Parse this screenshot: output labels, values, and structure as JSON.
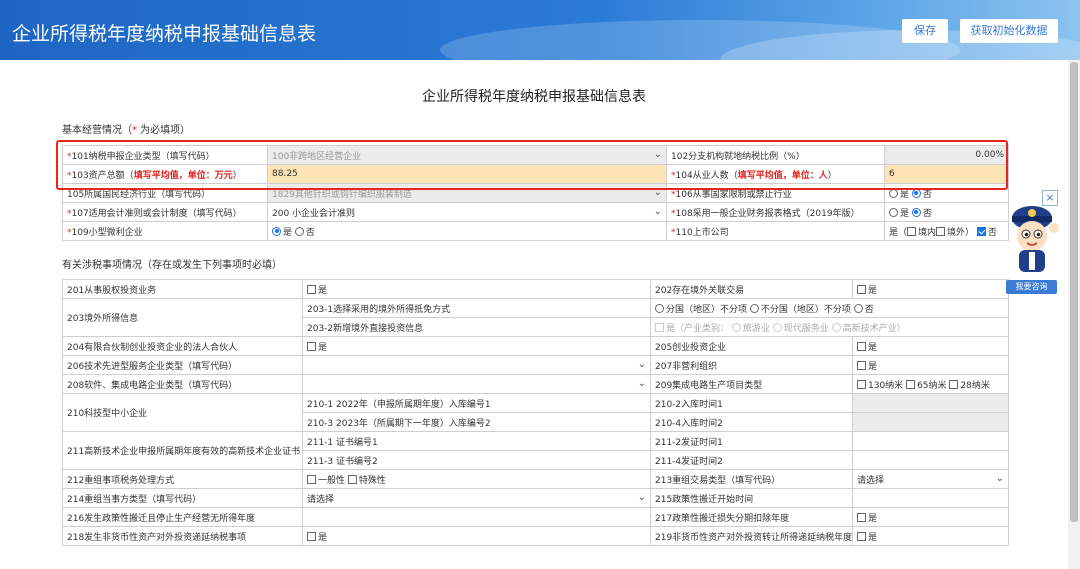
{
  "header": {
    "title": "企业所得税年度纳税申报基础信息表",
    "save_label": "保存",
    "init_label": "获取初始化数据"
  },
  "doc_title": "企业所得税年度纳税申报基础信息表",
  "section1": {
    "title_prefix": "基本经营情况（",
    "required_mark": "*",
    "title_suffix": " 为必填项）"
  },
  "basic": {
    "r101_label": "101纳税申报企业类型（填写代码）",
    "r101_value": "100非跨地区经营企业",
    "r102_label": "102分支机构就地纳税比例（%）",
    "r102_value": "0.00%",
    "r103_label": "103资产总额（",
    "r103_note": "填写平均值，单位：万元",
    "r103_end": "）",
    "r103_value": "88.25",
    "r104_label": "104从业人数（",
    "r104_note": "填写平均值，单位：人",
    "r104_end": "）",
    "r104_value": "6",
    "r105_label": "105所属国民经济行业（填写代码）",
    "r105_value": "1829其他针织或钩针编织服装制造",
    "r106_label": "106从事国家限制或禁止行业",
    "yes": "是",
    "no": "否",
    "r107_label": "107适用会计准则或会计制度（填写代码）",
    "r107_value": "200 小企业会计准则",
    "r108_label": "108采用一般企业财务报表格式（2019年版）",
    "r109_label": "109小型微利企业",
    "r110_label": "110上市公司",
    "r110_prefix": "是（",
    "r110_in": "境内",
    "r110_out": "境外）"
  },
  "section2": {
    "title": "有关涉税事项情况（存在或发生下列事项时必填）"
  },
  "tax": {
    "r201": "201从事股权投资业务",
    "r202": "202存在境外关联交易",
    "r203": "203境外所得信息",
    "r203_1": "203-1选择采用的境外所得抵免方式",
    "r203_1_a": "分国（地区）不分项",
    "r203_1_b": "不分国（地区）不分项",
    "r203_1_c": "否",
    "r203_2": "203-2新增境外直接投资信息",
    "r203_2_a": "是（产业类别：",
    "r203_2_b": "旅游业",
    "r203_2_c": "现代服务业",
    "r203_2_d": "高新技术产业）",
    "r204": "204有限合伙制创业投资企业的法人合伙人",
    "r205": "205创业投资企业",
    "r206": "206技术先进型服务企业类型（填写代码）",
    "r207": "207非营利组织",
    "r208": "208软件、集成电路企业类型（填写代码）",
    "r209": "209集成电路生产项目类型",
    "r209_a": "130纳米",
    "r209_b": "65纳米",
    "r209_c": "28纳米",
    "r210": "210科技型中小企业",
    "r210_1": "210-1 2022年（申报所属期年度）入库编号1",
    "r210_2": "210-2入库时间1",
    "r210_3": "210-3 2023年（所属期下一年度）入库编号2",
    "r210_4": "210-4入库时间2",
    "r211": "211高新技术企业申报所属期年度有效的高新技术企业证书",
    "r211_1": "211-1 证书编号1",
    "r211_2": "211-2发证时间1",
    "r211_3": "211-3 证书编号2",
    "r211_4": "211-4发证时间2",
    "r212": "212重组事项税务处理方式",
    "r212_a": "一般性",
    "r212_b": "特殊性",
    "r213": "213重组交易类型（填写代码）",
    "r213_value": "请选择",
    "r214": "214重组当事方类型（填写代码）",
    "r214_value": "请选择",
    "r215": "215政策性搬迁开始时间",
    "r216": "216发生政策性搬迁且停止生产经营无所得年度",
    "r217": "217政策性搬迁损失分期扣除年度",
    "r218": "218发生非货币性资产对外投资递延纳税事项",
    "r219": "219非货币性资产对外投资转让所得递延纳税年度"
  },
  "assistant": {
    "close": "×",
    "consult_label": "我要咨询"
  },
  "colors": {
    "header": "#1f66c4",
    "required": "#e02020",
    "highlight_border": "#e8261f",
    "readonly_fill": "#ebebeb",
    "input_fill": "#fce4b4"
  }
}
